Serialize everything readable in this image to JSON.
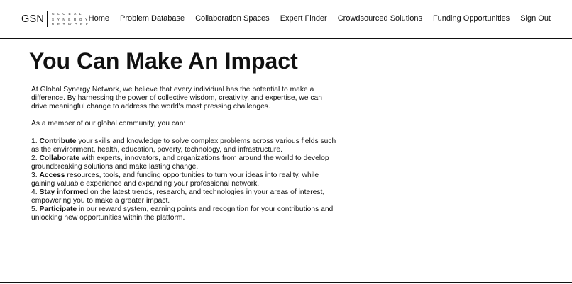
{
  "logo": {
    "mark": "GSN",
    "line1": "GLOBAL",
    "line2": "SYNERGY",
    "line3": "NETWORK"
  },
  "nav": {
    "home": "Home",
    "problem_database": "Problem Database",
    "collaboration_spaces": "Collaboration Spaces",
    "expert_finder": "Expert Finder",
    "crowdsourced_solutions": "Crowdsourced Solutions",
    "funding_opportunities": "Funding Opportunities",
    "sign_out": "Sign Out"
  },
  "main": {
    "title": "You Can Make An Impact",
    "intro": "At Global Synergy Network, we believe that every individual has the potential to make a difference. By harnessing the power of collective wisdom, creativity, and expertise, we can drive meaningful change to address the world's most pressing challenges.",
    "member_intro": "As a member of our global community, you can:",
    "items": [
      {
        "num": "1. ",
        "bold": "Contribute",
        "text": " your skills and knowledge to solve complex problems across various fields such as the environment, health, education, poverty, technology, and infrastructure."
      },
      {
        "num": "2. ",
        "bold": "Collaborate",
        "text": " with experts, innovators, and organizations from around the world to develop groundbreaking solutions and make lasting change."
      },
      {
        "num": "3. ",
        "bold": "Access",
        "text": " resources, tools, and funding opportunities to turn your ideas into reality, while gaining valuable experience and expanding your professional network."
      },
      {
        "num": "4. ",
        "bold": "Stay informed",
        "text": " on the latest trends, research, and technologies in your areas of interest, empowering you to make a greater impact."
      },
      {
        "num": "5. ",
        "bold": "Participate",
        "text": " in our reward system, earning points and recognition for your contributions and unlocking new opportunities within the platform."
      }
    ]
  }
}
